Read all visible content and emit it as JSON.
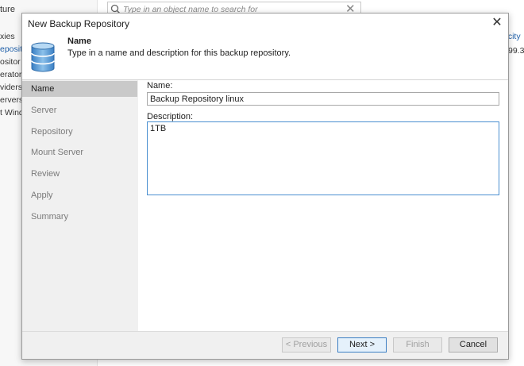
{
  "background": {
    "left_title": "ture",
    "left_items": [
      "xies",
      "epositori",
      "ositor",
      "erators",
      "viders",
      "ervers",
      "t Wind"
    ],
    "search_placeholder": "Type in an object name to search for",
    "right_header": "acity",
    "right_value": "99.3"
  },
  "dialog": {
    "title": "New Backup Repository",
    "header_title": "Name",
    "header_description": "Type in a name and description for this backup repository.",
    "steps": [
      "Name",
      "Server",
      "Repository",
      "Mount Server",
      "Review",
      "Apply",
      "Summary"
    ],
    "active_step": "Name",
    "name_label": "Name:",
    "name_value": "Backup Repository linux",
    "description_label": "Description:",
    "description_value": "1TB",
    "buttons": {
      "previous": "< Previous",
      "next": "Next >",
      "finish": "Finish",
      "cancel": "Cancel"
    }
  },
  "icons": {
    "close": "close-icon",
    "repository": "database-icon",
    "search": "search-icon",
    "clear": "clear-icon"
  },
  "colors": {
    "accent": "#1f5fa8",
    "focus_border": "#4a8fd0",
    "step_active": "#c9c9c9"
  }
}
